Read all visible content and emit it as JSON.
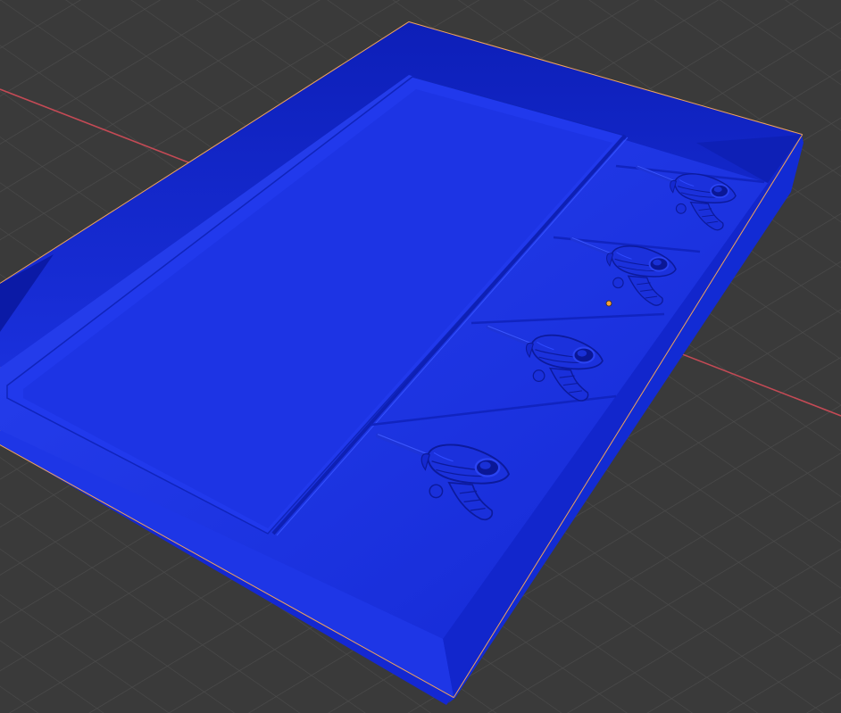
{
  "app": "3D viewport",
  "viewport": {
    "background_color": "#3a3a3a",
    "grid_color": "#4b4b4b",
    "x_axis_color": "#c44a55",
    "selection_outline_color": "#f0a35a",
    "origin_color": "#f5a03a"
  },
  "object": {
    "kind": "tray",
    "selected": true,
    "material_color": "#1a30e0",
    "shading": {
      "light": "#2a43f2",
      "mid": "#1c33e0",
      "dark": "#0f22c4",
      "shadow": "#0a1aa8"
    },
    "compartments": 2,
    "figures": [
      {
        "name": "figure-1",
        "icon": "rocket-figure-icon"
      },
      {
        "name": "figure-2",
        "icon": "rocket-figure-icon"
      },
      {
        "name": "figure-3",
        "icon": "rocket-figure-icon"
      },
      {
        "name": "figure-4",
        "icon": "rocket-figure-icon"
      }
    ]
  }
}
